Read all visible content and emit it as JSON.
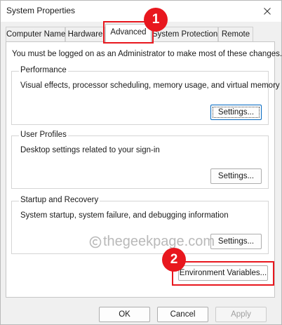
{
  "window": {
    "title": "System Properties",
    "close_glyph": "✕"
  },
  "tabs": [
    {
      "label": "Computer Name",
      "active": false
    },
    {
      "label": "Hardware",
      "active": false
    },
    {
      "label": "Advanced",
      "active": true
    },
    {
      "label": "System Protection",
      "active": false
    },
    {
      "label": "Remote",
      "active": false
    }
  ],
  "advanced": {
    "notice": "You must be logged on as an Administrator to make most of these changes.",
    "performance": {
      "label": "Performance",
      "description": "Visual effects, processor scheduling, memory usage, and virtual memory",
      "button": "Settings..."
    },
    "user_profiles": {
      "label": "User Profiles",
      "description": "Desktop settings related to your sign-in",
      "button": "Settings..."
    },
    "startup_recovery": {
      "label": "Startup and Recovery",
      "description": "System startup, system failure, and debugging information",
      "button": "Settings..."
    },
    "env_button": "Environment Variables..."
  },
  "watermark": {
    "text": "thegeekpage.com"
  },
  "footer": {
    "ok": "OK",
    "cancel": "Cancel",
    "apply": "Apply"
  },
  "annotations": {
    "step1": "1",
    "step2": "2",
    "color": "#e8171e"
  }
}
